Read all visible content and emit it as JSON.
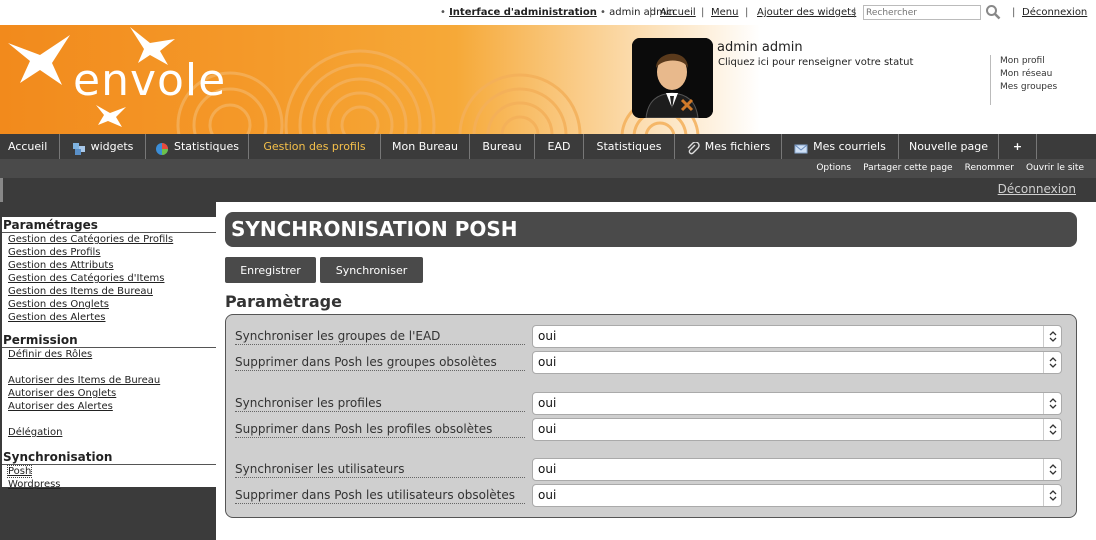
{
  "topbar": {
    "admin_link": "Interface d'administration",
    "user": "admin admin",
    "accueil": "Accueil",
    "menu": "Menu",
    "add_widgets": "Ajouter des widgets",
    "search_placeholder": "Rechercher",
    "logout": "Déconnexion"
  },
  "banner": {
    "logo_text": "envole",
    "user_name": "admin admin",
    "status_prompt": "Cliquez ici pour renseigner votre statut",
    "profile_links": [
      "Mon profil",
      "Mon réseau",
      "Mes groupes"
    ]
  },
  "mainnav": {
    "tabs": [
      {
        "label": "Accueil",
        "icon": ""
      },
      {
        "label": "widgets",
        "icon": "widgets-icon"
      },
      {
        "label": "Statistiques",
        "icon": "chart-globe-icon"
      },
      {
        "label": "Gestion des profils",
        "icon": "",
        "active": true
      },
      {
        "label": "Mon Bureau",
        "icon": ""
      },
      {
        "label": "Bureau",
        "icon": ""
      },
      {
        "label": "EAD",
        "icon": ""
      },
      {
        "label": "Statistiques",
        "icon": ""
      },
      {
        "label": "Mes fichiers",
        "icon": "paperclip-icon"
      },
      {
        "label": "Mes courriels",
        "icon": "envelope-icon"
      },
      {
        "label": "Nouvelle page",
        "icon": ""
      },
      {
        "label": "+",
        "icon": ""
      }
    ],
    "active_color": "#f5c04a"
  },
  "subnav": {
    "items": [
      "Options",
      "Partager cette page",
      "Renommer",
      "Ouvrir le site"
    ]
  },
  "logoutbar": {
    "label": "Déconnexion"
  },
  "sidebar": {
    "sections": [
      {
        "title": "Paramétrages",
        "links": [
          "Gestion des Catégories de Profils",
          "Gestion des Profils",
          "Gestion des Attributs",
          "Gestion des Catégories d'Items",
          "Gestion des Items de Bureau",
          "Gestion des Onglets",
          "Gestion des Alertes"
        ]
      },
      {
        "title": "Permission",
        "links": [
          "Définir des Rôles",
          "",
          "Autoriser des Items de Bureau",
          "Autoriser des Onglets",
          "Autoriser des Alertes",
          "",
          "Délégation"
        ]
      },
      {
        "title": "Synchronisation",
        "links": [
          "Posh",
          "Wordpress"
        ]
      }
    ]
  },
  "content": {
    "title": "SYNCHRONISATION POSH",
    "buttons": {
      "save": "Enregistrer",
      "sync": "Synchroniser"
    },
    "section_title": "Paramètrage",
    "rows": [
      {
        "label": "Synchroniser les groupes de l'EAD",
        "value": "oui"
      },
      {
        "label": "Supprimer dans Posh les groupes obsolètes",
        "value": "oui"
      },
      {
        "label": "Synchroniser les profiles",
        "value": "oui"
      },
      {
        "label": "Supprimer dans Posh les profiles obsolètes",
        "value": "oui"
      },
      {
        "label": "Synchroniser les utilisateurs",
        "value": "oui"
      },
      {
        "label": "Supprimer dans Posh les utilisateurs obsolètes",
        "value": "oui"
      }
    ]
  },
  "colors": {
    "banner_orange": "#f28a1c",
    "nav_dark": "#3b3b3b",
    "form_bg": "#cfcfcf"
  }
}
